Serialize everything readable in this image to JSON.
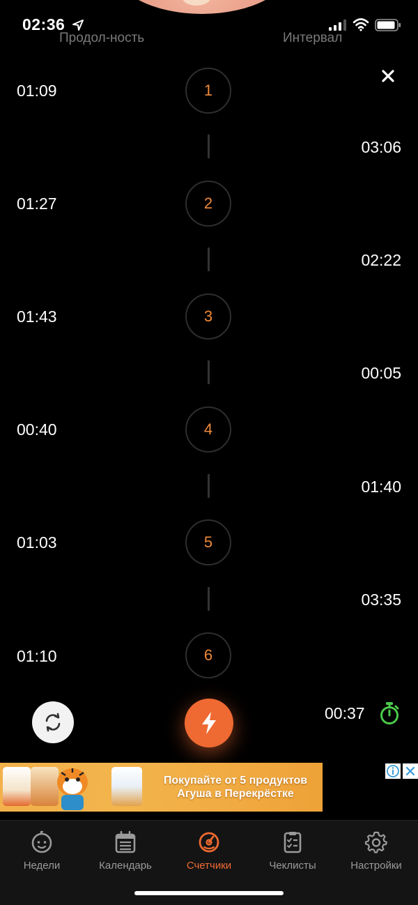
{
  "status_bar": {
    "time": "02:36"
  },
  "headers": {
    "duration": "Продол-ность",
    "interval": "Интервал"
  },
  "contractions": [
    {
      "number": "1",
      "duration": "01:09",
      "interval": "03:06"
    },
    {
      "number": "2",
      "duration": "01:27",
      "interval": "02:22"
    },
    {
      "number": "3",
      "duration": "01:43",
      "interval": "00:05"
    },
    {
      "number": "4",
      "duration": "00:40",
      "interval": "01:40"
    },
    {
      "number": "5",
      "duration": "01:03",
      "interval": "03:35"
    },
    {
      "number": "6",
      "duration": "01:10"
    }
  ],
  "timer": {
    "value": "00:37"
  },
  "ad": {
    "headline_line1": "Покупайте от 5 продуктов",
    "headline_line2": "Агуша в Перекрёстке"
  },
  "tabs": [
    {
      "label": "Недели",
      "icon": "baby-face-icon"
    },
    {
      "label": "Календарь",
      "icon": "calendar-icon"
    },
    {
      "label": "Счетчики",
      "icon": "counter-dial-icon",
      "active": true
    },
    {
      "label": "Чеклисты",
      "icon": "checklist-icon"
    },
    {
      "label": "Настройки",
      "icon": "gear-icon"
    }
  ],
  "colors": {
    "accent": "#ef6a32",
    "number": "#ef8a3a",
    "stopwatch": "#4cc94b",
    "background": "#000000"
  }
}
